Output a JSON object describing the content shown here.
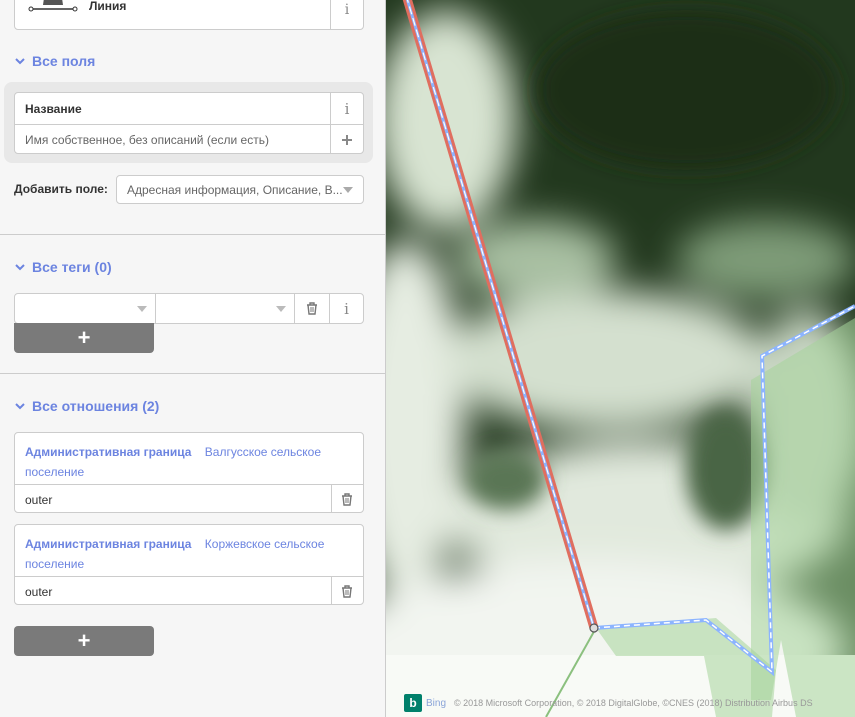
{
  "preset": {
    "label": "Линия"
  },
  "all_fields": {
    "header": "Все поля",
    "name_label": "Название",
    "name_placeholder": "Имя собственное, без описаний (если есть)",
    "add_field_label": "Добавить поле:",
    "add_field_value": "Адресная информация, Описание, В..."
  },
  "all_tags": {
    "header": "Все теги (0)",
    "add": "+"
  },
  "all_relations": {
    "header": "Все отношения (2)",
    "items": [
      {
        "type": "Административная граница",
        "name_line1": "Валгусское сельское",
        "name_line2": "поселение",
        "role": "outer"
      },
      {
        "type": "Административная граница",
        "name_line1": "Коржевское сельское",
        "name_line2": "поселение",
        "role": "outer"
      }
    ],
    "add": "+"
  },
  "map": {
    "bing_label": "Bing",
    "attribution": "© 2018 Microsoft Corporation, © 2018 DigitalGlobe, ©CNES (2018) Distribution Airbus DS"
  },
  "colors": {
    "accent": "#6c84e0",
    "selected_line": "#e06e5f",
    "boundary": "#8cb4ff"
  },
  "icons": {
    "info": "info-icon",
    "plus": "plus-icon",
    "delete": "trash-icon",
    "chevron": "chevron-down-icon"
  }
}
